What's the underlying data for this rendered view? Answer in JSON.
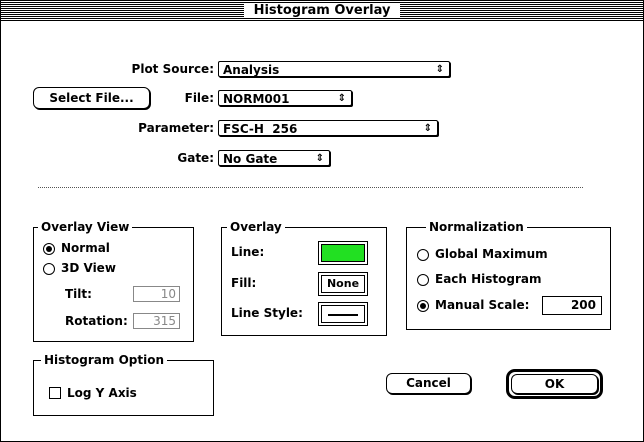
{
  "window": {
    "title": "Histogram Overlay"
  },
  "source": {
    "plot_source_label": "Plot Source:",
    "plot_source_value": "Analysis",
    "select_file_label": "Select File...",
    "file_label": "File:",
    "file_value": "NORM001",
    "parameter_label": "Parameter:",
    "parameter_value": "FSC-H  256",
    "gate_label": "Gate:",
    "gate_value": "No Gate",
    "popup_arrow": "⇕"
  },
  "overlay_view": {
    "title": "Overlay View",
    "normal_label": "Normal",
    "normal_selected": true,
    "view3d_label": "3D View",
    "view3d_selected": false,
    "tilt_label": "Tilt:",
    "tilt_value": "10",
    "rotation_label": "Rotation:",
    "rotation_value": "315"
  },
  "overlay": {
    "title": "Overlay",
    "line_label": "Line:",
    "line_color": "#22e022",
    "fill_label": "Fill:",
    "fill_value": "None",
    "line_style_label": "Line Style:"
  },
  "normalization": {
    "title": "Normalization",
    "global_label": "Global Maximum",
    "global_selected": false,
    "each_label": "Each Histogram",
    "each_selected": false,
    "manual_label": "Manual Scale:",
    "manual_selected": true,
    "manual_value": "200"
  },
  "histogram_option": {
    "title": "Histogram Option",
    "log_y_label": "Log Y Axis",
    "log_y_checked": false
  },
  "buttons": {
    "cancel": "Cancel",
    "ok": "OK"
  }
}
